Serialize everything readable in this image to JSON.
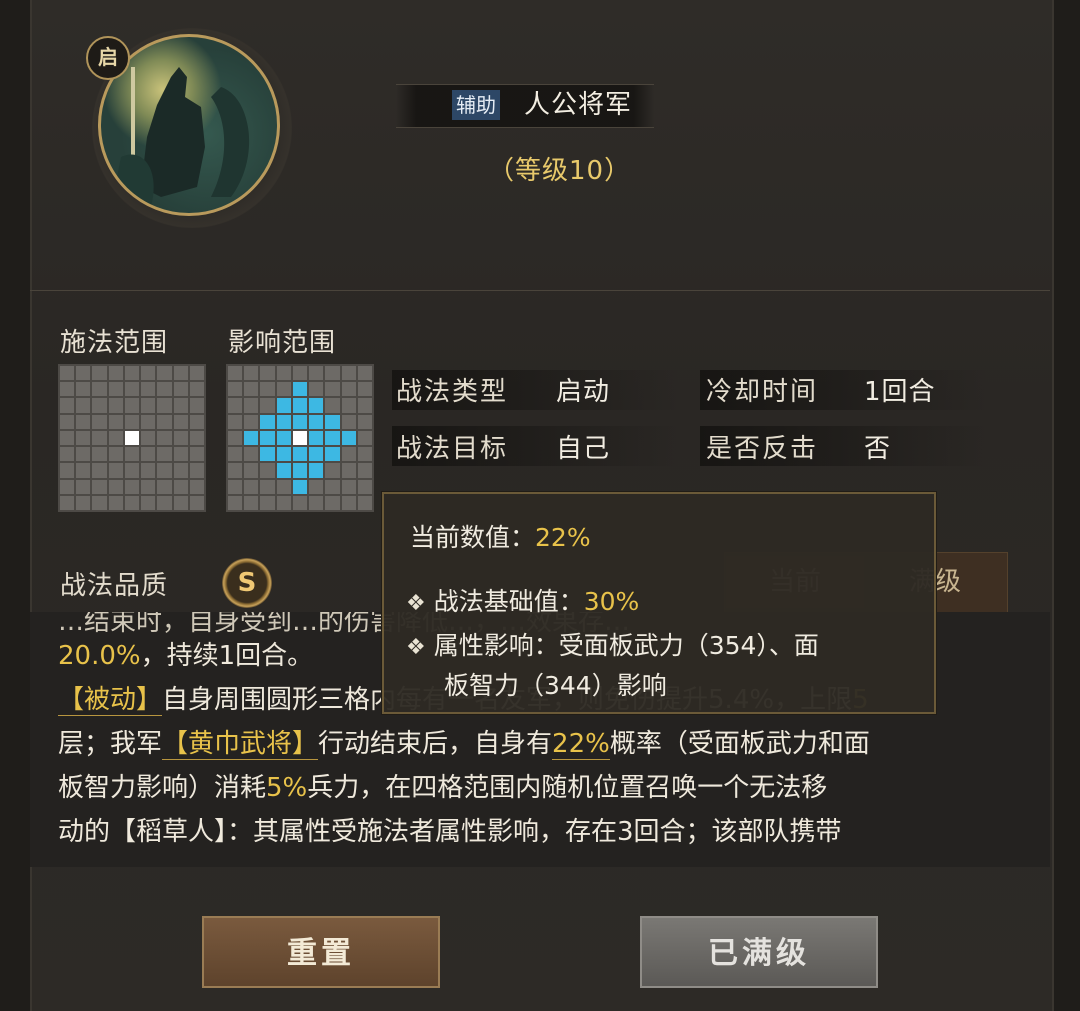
{
  "header": {
    "badge": "启",
    "tag": "辅助",
    "skill_name": "人公将军",
    "level": "（等级10）"
  },
  "ranges": {
    "cast_label": "施法范围",
    "effect_label": "影响范围"
  },
  "attributes": {
    "type_label": "战法类型",
    "type_value": "启动",
    "cooldown_label": "冷却时间",
    "cooldown_value": "1回合",
    "target_label": "战法目标",
    "target_value": "自己",
    "counter_label": "是否反击",
    "counter_value": "否"
  },
  "quality": {
    "label": "战法品质",
    "grade": "S",
    "toggle_current": "当前",
    "toggle_max": "满级"
  },
  "description": {
    "line0": "…结束时，自身受到…的伤害降低…，…效果存…",
    "line1_val": "20.0%",
    "line1_rest": "，持续1回合。",
    "line2_kw": "【被动】",
    "line2_rest": "自身周围圆形三格内每有一名友军，则免伤提升5.4%，上限",
    "line2_val": "5",
    "line3_a": "层；我军",
    "line3_kw": "【黄巾武将】",
    "line3_b": "行动结束后，自身有",
    "line3_val": "22%",
    "line3_c": "概率（受面板武力和面",
    "line4_a": "板智力影响）消耗",
    "line4_val": "5%",
    "line4_b": "兵力，在四格范围内随机位置召唤一个无法移",
    "line5": "动的【稻草人】：其属性受施法者属性影响，存在3回合；该部队携带"
  },
  "tooltip": {
    "current_label": "当前数值：",
    "current_value": "22%",
    "base_label": "战法基础值：",
    "base_value": "30%",
    "attr_line1": "属性影响：受面板武力（354）、面",
    "attr_line2": "板智力（344）影响",
    "bullet": "❖"
  },
  "buttons": {
    "reset": "重置",
    "maxed": "已满级"
  }
}
